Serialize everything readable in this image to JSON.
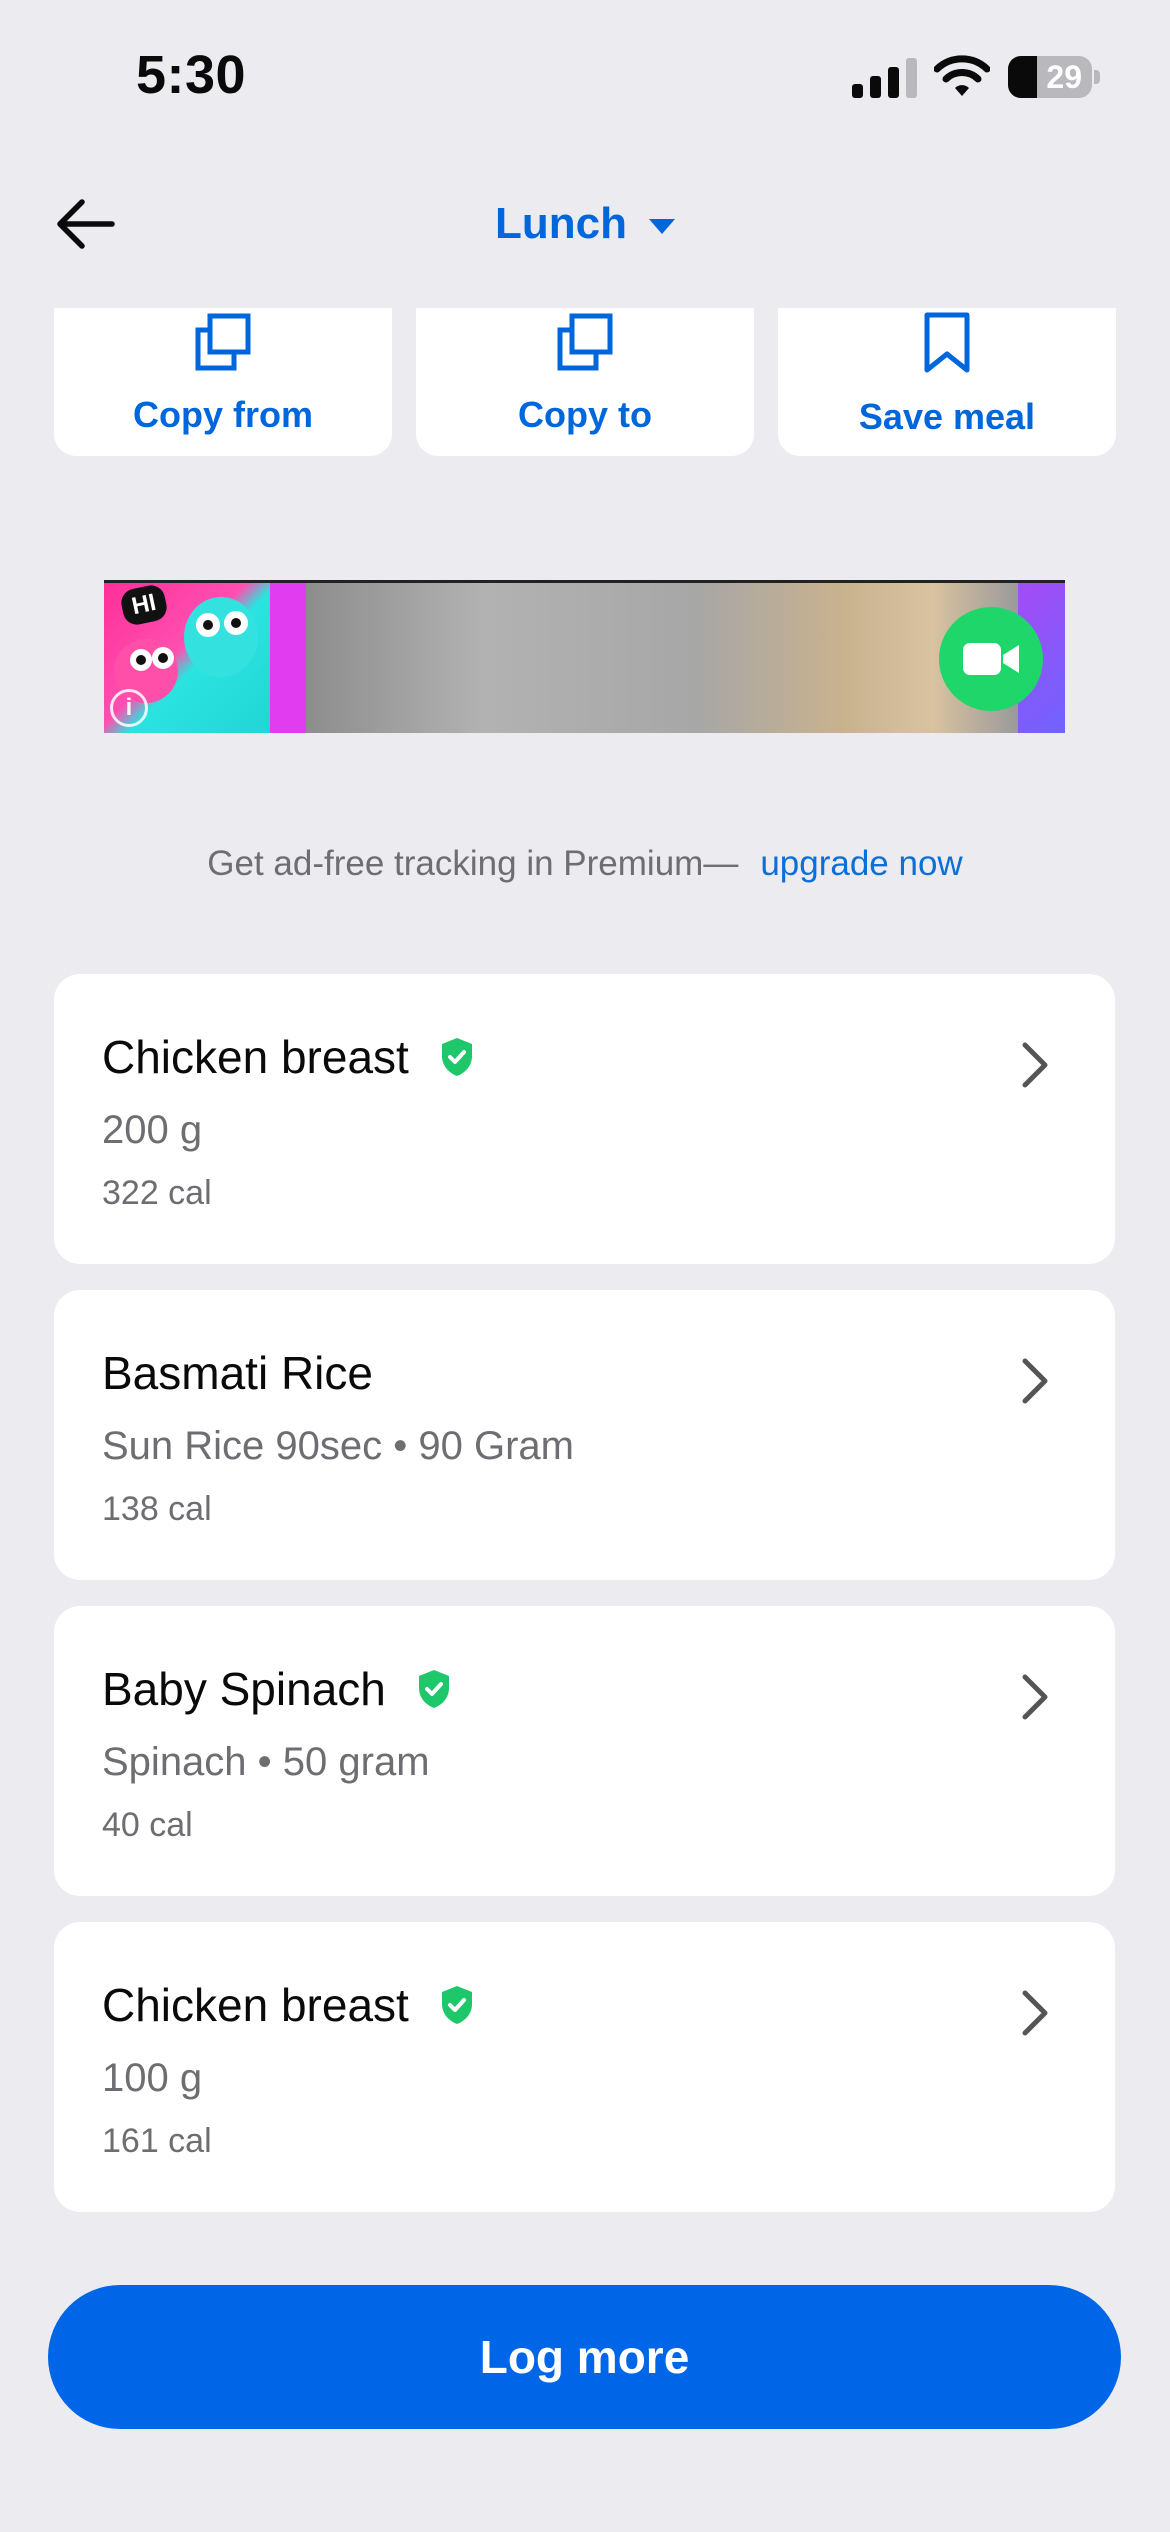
{
  "status_bar": {
    "time": "5:30",
    "battery_level": "29"
  },
  "header": {
    "meal_title": "Lunch"
  },
  "actions": {
    "copy_from": "Copy from",
    "copy_to": "Copy to",
    "save_meal": "Save meal"
  },
  "ad": {
    "badge": "HI",
    "info_icon": "i"
  },
  "premium": {
    "text": "Get ad-free tracking in Premium—",
    "link": "upgrade now"
  },
  "foods": [
    {
      "name": "Chicken breast",
      "verified": true,
      "detail": "200 g",
      "calories": "322 cal"
    },
    {
      "name": "Basmati Rice",
      "verified": false,
      "detail": "Sun Rice 90sec • 90 Gram",
      "calories": "138 cal"
    },
    {
      "name": "Baby Spinach",
      "verified": true,
      "detail": "Spinach • 50 gram",
      "calories": "40 cal"
    },
    {
      "name": "Chicken breast",
      "verified": true,
      "detail": "100 g",
      "calories": "161 cal"
    }
  ],
  "footer": {
    "log_more": "Log more"
  },
  "colors": {
    "accent": "#0066db",
    "verified_green": "#1ec76a",
    "background": "#ebebf0"
  }
}
